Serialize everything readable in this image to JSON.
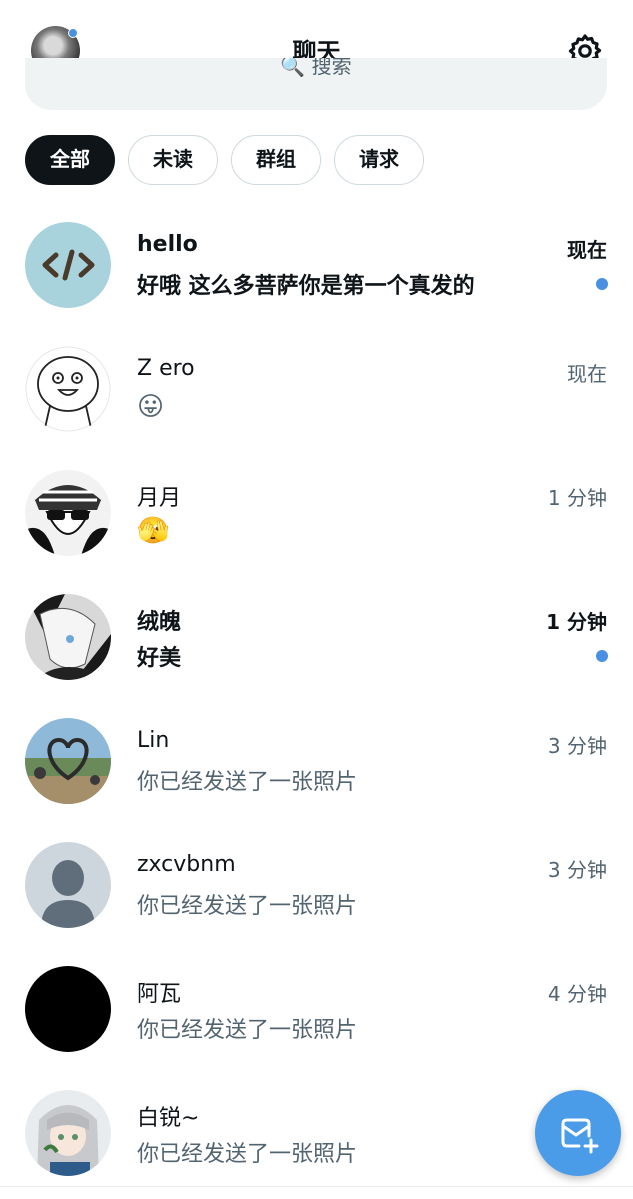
{
  "header": {
    "title": "聊天",
    "search_placeholder": "搜索"
  },
  "filters": [
    {
      "label": "全部",
      "active": true
    },
    {
      "label": "未读",
      "active": false
    },
    {
      "label": "群组",
      "active": false
    },
    {
      "label": "请求",
      "active": false
    }
  ],
  "conversations": [
    {
      "name": "hello",
      "preview": "好哦 这么多菩萨你是第一个真发的",
      "time": "现在",
      "unread": true,
      "avatar": "code-icon"
    },
    {
      "name": "Z ero",
      "preview": "😛",
      "time": "现在",
      "unread": false,
      "avatar": "doodle-face"
    },
    {
      "name": "月月",
      "preview": "🫣",
      "time": "1 分钟",
      "unread": false,
      "avatar": "manga-sunglasses"
    },
    {
      "name": "绒魄",
      "preview": "好美",
      "time": "1 分钟",
      "unread": true,
      "avatar": "anime-white-hair"
    },
    {
      "name": "Lin",
      "preview": "你已经发送了一张照片",
      "time": "3 分钟",
      "unread": false,
      "avatar": "photo-heart-frame"
    },
    {
      "name": "zxcvbnm",
      "preview": "你已经发送了一张照片",
      "time": "3 分钟",
      "unread": false,
      "avatar": "default-person"
    },
    {
      "name": "阿瓦",
      "preview": "你已经发送了一张照片",
      "time": "4 分钟",
      "unread": false,
      "avatar": "black-circle"
    },
    {
      "name": "白锐~",
      "preview": "你已经发送了一张照片",
      "time": "",
      "unread": false,
      "avatar": "anime-silver-hair"
    }
  ],
  "fab": {
    "icon": "new-message-icon"
  },
  "colors": {
    "accent": "#4a90e2",
    "fab": "#4a9be8",
    "text": "#0f1419",
    "muted": "#536471"
  }
}
